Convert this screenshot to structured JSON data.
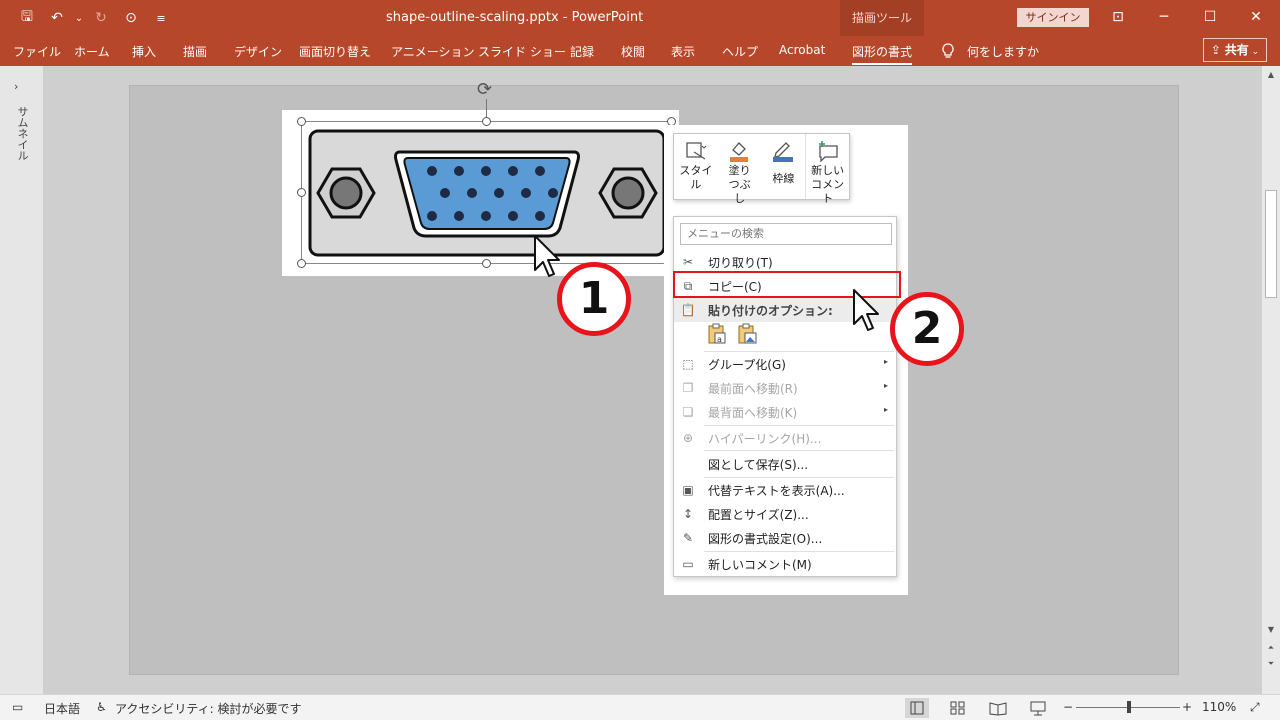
{
  "window": {
    "title": "shape-outline-scaling.pptx  -  PowerPoint",
    "context_tool": "描画ツール",
    "signin": "サインイン",
    "minimize": "─",
    "restore": "☐",
    "close": "✕",
    "ribbon_display": "⊡"
  },
  "qat": {
    "save": "🖫",
    "undo": "↶",
    "undo_dropdown": "⌄",
    "redo": "↻",
    "present": "⊙",
    "customize": "≡"
  },
  "ribbon": {
    "tabs": [
      "ファイル",
      "ホーム",
      "挿入",
      "描画",
      "デザイン",
      "画面切り替え",
      "アニメーション",
      "スライド ショー",
      "記録",
      "校閲",
      "表示",
      "ヘルプ",
      "Acrobat",
      "図形の書式"
    ],
    "active_tab": "図形の書式",
    "tell_me": "何をしますか",
    "share": "共有"
  },
  "thumbnails": {
    "arrow": "›",
    "label": "サムネイル"
  },
  "mini_toolbar": {
    "style": "スタイル",
    "fill": "塗りつぶし",
    "outline": "枠線",
    "new_comment": "新しいコメント"
  },
  "context_menu": {
    "search_placeholder": "メニューの検索",
    "items": [
      {
        "label": "切り取り(T)",
        "icon": "scissors-icon"
      },
      {
        "label": "コピー(C)",
        "icon": "copy-icon"
      },
      {
        "label": "貼り付けのオプション:",
        "icon": "paste-icon"
      },
      {
        "label": "グループ化(G)",
        "icon": "group-icon"
      },
      {
        "label": "最前面へ移動(R)",
        "icon": "bring-front-icon"
      },
      {
        "label": "最背面へ移動(K)",
        "icon": "send-back-icon"
      },
      {
        "label": "ハイパーリンク(H)...",
        "icon": "hyperlink-icon"
      },
      {
        "label": "図として保存(S)...",
        "icon": ""
      },
      {
        "label": "代替テキストを表示(A)...",
        "icon": "alt-text-icon"
      },
      {
        "label": "配置とサイズ(Z)...",
        "icon": "size-position-icon"
      },
      {
        "label": "図形の書式設定(O)...",
        "icon": "format-shape-icon"
      },
      {
        "label": "新しいコメント(M)",
        "icon": "comment-icon"
      }
    ],
    "submenu_arrow": "▸"
  },
  "steps": {
    "one": "1",
    "two": "2"
  },
  "statusbar": {
    "language": "日本語",
    "accessibility": "アクセシビリティ: 検討が必要です",
    "zoom_out": "−",
    "zoom_in": "+",
    "zoom": "110%"
  },
  "colors": {
    "accent": "#b7472a",
    "highlight": "#e8141c",
    "vga_blue": "#5b9bd5"
  }
}
